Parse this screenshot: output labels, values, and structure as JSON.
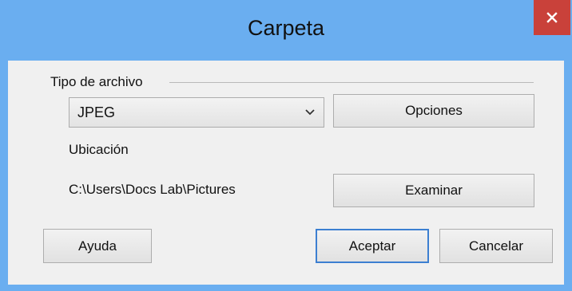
{
  "window": {
    "title": "Carpeta"
  },
  "group": {
    "label": "Tipo de archivo"
  },
  "file_type": {
    "selected": "JPEG"
  },
  "buttons": {
    "options": "Opciones",
    "browse": "Examinar",
    "help": "Ayuda",
    "accept": "Aceptar",
    "cancel": "Cancelar"
  },
  "location": {
    "label": "Ubicación",
    "path": "C:\\Users\\Docs Lab\\Pictures"
  },
  "colors": {
    "titlebar": "#6aaef0",
    "close": "#c9413a",
    "client": "#f0f0f0",
    "default_button_border": "#3c7fd1"
  },
  "icons": {
    "close": "close-icon",
    "dropdown": "chevron-down-icon"
  }
}
